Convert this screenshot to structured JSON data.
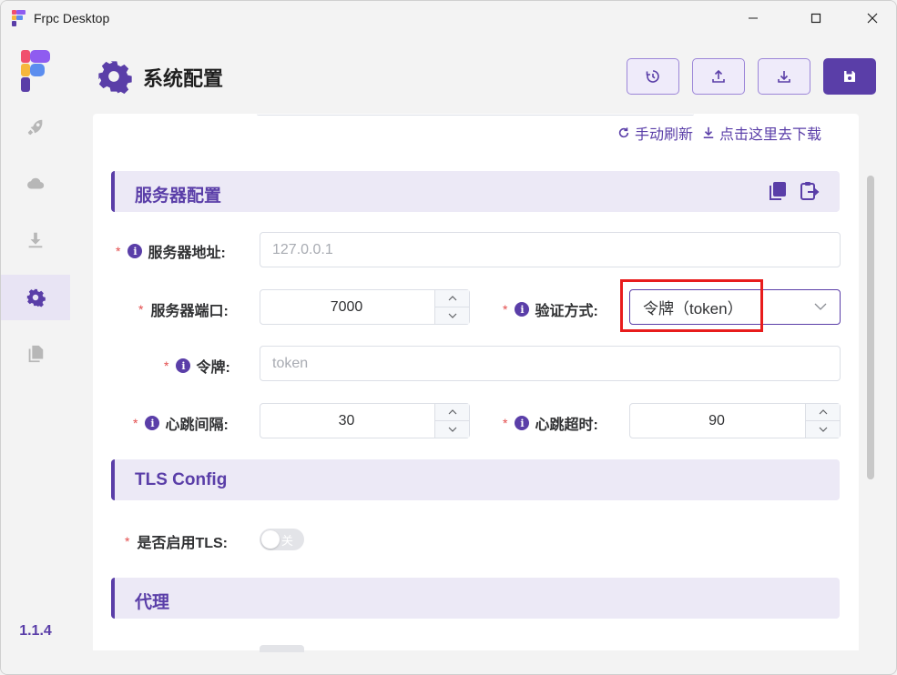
{
  "window": {
    "title": "Frpc Desktop"
  },
  "app": {
    "version": "1.1.4",
    "accent": "#5a3ea8"
  },
  "sidebar": {
    "items": [
      {
        "icon": "rocket-icon",
        "active": false
      },
      {
        "icon": "cloud-icon",
        "active": false
      },
      {
        "icon": "download-icon",
        "active": false
      },
      {
        "icon": "gear-icon",
        "active": true
      },
      {
        "icon": "document-icon",
        "active": false
      }
    ]
  },
  "header": {
    "title": "系统配置",
    "buttons": [
      "history-icon",
      "upload-icon",
      "download-icon",
      "save-icon"
    ]
  },
  "top_links": {
    "refresh": "手动刷新",
    "download": "点击这里去下载"
  },
  "server_section": {
    "title": "服务器配置",
    "server_addr": {
      "label": "服务器地址:",
      "placeholder": "127.0.0.1"
    },
    "server_port": {
      "label": "服务器端口:",
      "value": "7000"
    },
    "auth_method": {
      "label": "验证方式:",
      "value": "令牌（token）"
    },
    "token": {
      "label": "令牌:",
      "placeholder": "token"
    },
    "heartbeat_interval": {
      "label": "心跳间隔:",
      "value": "30"
    },
    "heartbeat_timeout": {
      "label": "心跳超时:",
      "value": "90"
    }
  },
  "tls_section": {
    "title": "TLS Config",
    "enable_tls": {
      "label": "是否启用TLS:",
      "state_text": "关"
    }
  },
  "proxy_section": {
    "title": "代理"
  }
}
